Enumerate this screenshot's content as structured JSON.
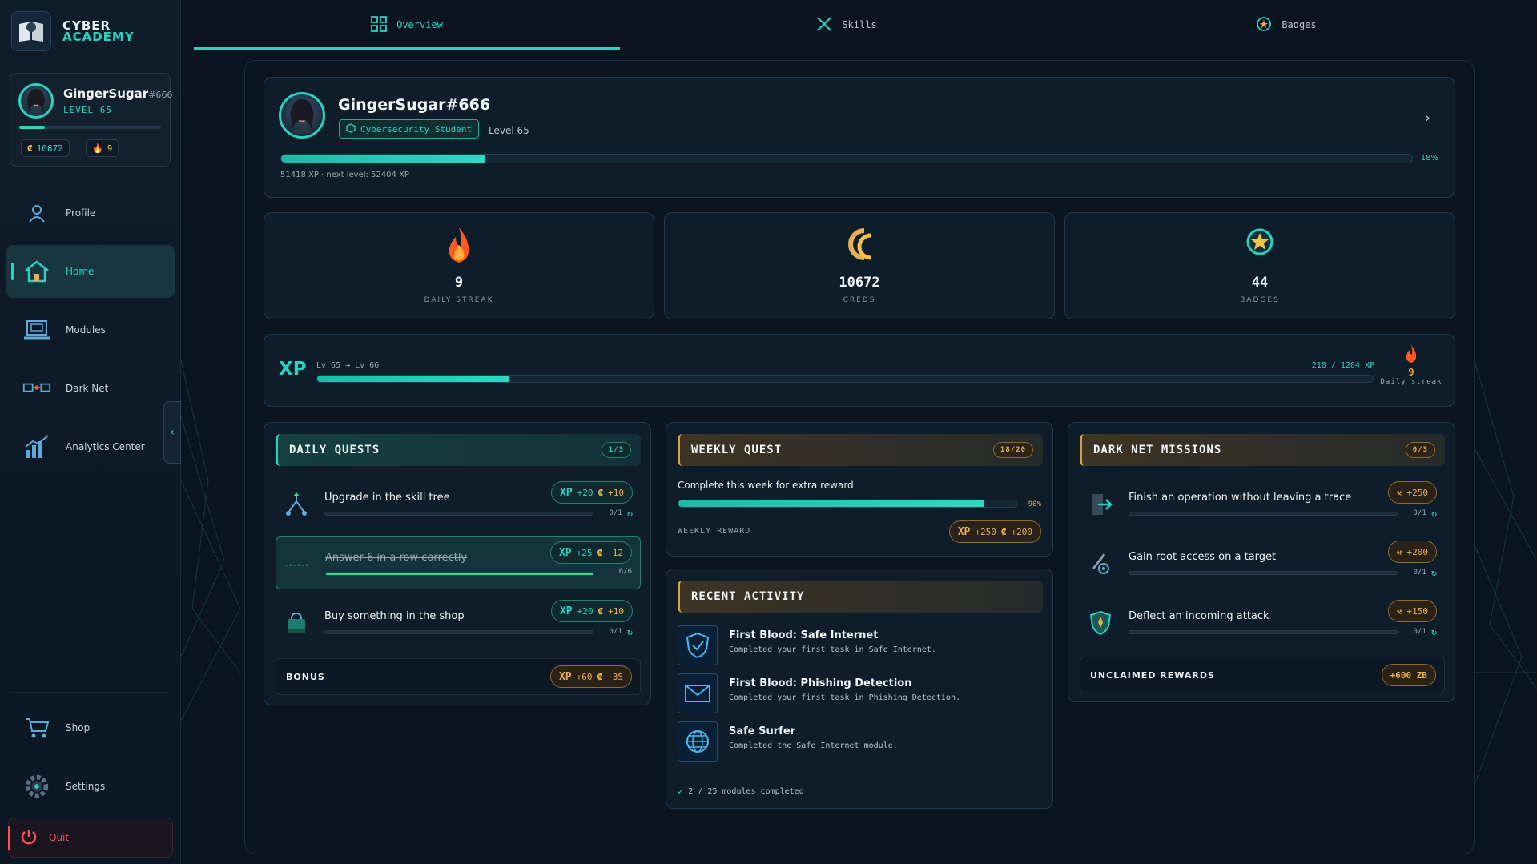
{
  "app": {
    "logo_line1": "CYBER",
    "logo_line2": "ACADEMY",
    "accent_color": "#29d3c0",
    "gold_color": "#e8b050"
  },
  "user_card": {
    "name": "GingerSugar",
    "tag": "#666",
    "level_label": "LEVEL 65",
    "level_progress": 0.18,
    "creds": "10672",
    "streak": "9"
  },
  "nav": {
    "items": [
      {
        "label": "Profile",
        "icon": "user-icon"
      },
      {
        "label": "Home",
        "icon": "home-icon",
        "active": true
      },
      {
        "label": "Modules",
        "icon": "laptop-icon"
      },
      {
        "label": "Dark Net",
        "icon": "network-icon"
      },
      {
        "label": "Analytics Center",
        "icon": "chart-icon"
      }
    ],
    "bottom": [
      {
        "label": "Shop",
        "icon": "cart-icon"
      },
      {
        "label": "Settings",
        "icon": "gear-icon"
      }
    ],
    "quit_label": "Quit"
  },
  "tabs": [
    {
      "label": "Overview",
      "icon": "grid-icon",
      "active": true
    },
    {
      "label": "Skills",
      "icon": "swords-icon"
    },
    {
      "label": "Badges",
      "icon": "badge-icon"
    }
  ],
  "profile": {
    "name": "GingerSugar#666",
    "role": "Cybersecurity Student",
    "level": "Level 65",
    "progress_pct": "18%",
    "progress": 0.18,
    "xp_text": "51418 XP",
    "next_level_text": "next level: 52404 XP"
  },
  "stats": [
    {
      "value": "9",
      "label": "DAILY STREAK",
      "icon": "flame-icon"
    },
    {
      "value": "10672",
      "label": "CREDS",
      "icon": "creds-icon"
    },
    {
      "value": "44",
      "label": "BADGES",
      "icon": "star-badge-icon"
    }
  ],
  "xp_bar": {
    "big": "XP",
    "level_range": "Lv 65 → Lv 66",
    "numbers": "218 / 1204 XP",
    "progress": 0.181,
    "streak_value": "9",
    "streak_label": "Daily streak"
  },
  "daily_quests": {
    "title": "DAILY QUESTS",
    "count": "1/3",
    "items": [
      {
        "title": "Upgrade in the skill tree",
        "xp": "+20",
        "creds": "+10",
        "progress": "0/1",
        "done": false,
        "fill": 0
      },
      {
        "title": "Answer 6 in a row correctly",
        "xp": "+25",
        "creds": "+12",
        "progress": "6/6",
        "done": true,
        "fill": 1
      },
      {
        "title": "Buy something in the shop",
        "xp": "+20",
        "creds": "+10",
        "progress": "0/1",
        "done": false,
        "fill": 0
      }
    ],
    "bonus_label": "BONUS",
    "bonus_xp": "+60",
    "bonus_creds": "+35"
  },
  "weekly_quest": {
    "title": "WEEKLY QUEST",
    "count": "18/20",
    "description": "Complete this week for extra reward",
    "progress_pct": "90%",
    "progress": 0.9,
    "reward_label": "WEEKLY REWARD",
    "reward_xp": "+250",
    "reward_creds": "+200"
  },
  "recent_activity": {
    "title": "RECENT ACTIVITY",
    "items": [
      {
        "title": "First Blood: Safe Internet",
        "sub": "Completed your first task in Safe Internet.",
        "icon": "shield-icon"
      },
      {
        "title": "First Blood: Phishing Detection",
        "sub": "Completed your first task in Phishing Detection.",
        "icon": "mail-icon"
      },
      {
        "title": "Safe Surfer",
        "sub": "Completed the Safe Internet module.",
        "icon": "globe-icon"
      }
    ],
    "footer": "2 / 25 modules completed"
  },
  "dark_net": {
    "title": "DARK NET MISSIONS",
    "count": "0/3",
    "items": [
      {
        "title": "Finish an operation without leaving a trace",
        "reward": "+250",
        "progress": "0/1",
        "icon": "exit-door-icon"
      },
      {
        "title": "Gain root access on a target",
        "reward": "+200",
        "progress": "0/1",
        "icon": "key-icon"
      },
      {
        "title": "Deflect an incoming attack",
        "reward": "+150",
        "progress": "0/1",
        "icon": "shield-icon"
      }
    ],
    "unclaimed_label": "UNCLAIMED REWARDS",
    "unclaimed_value": "+600 ZB"
  }
}
